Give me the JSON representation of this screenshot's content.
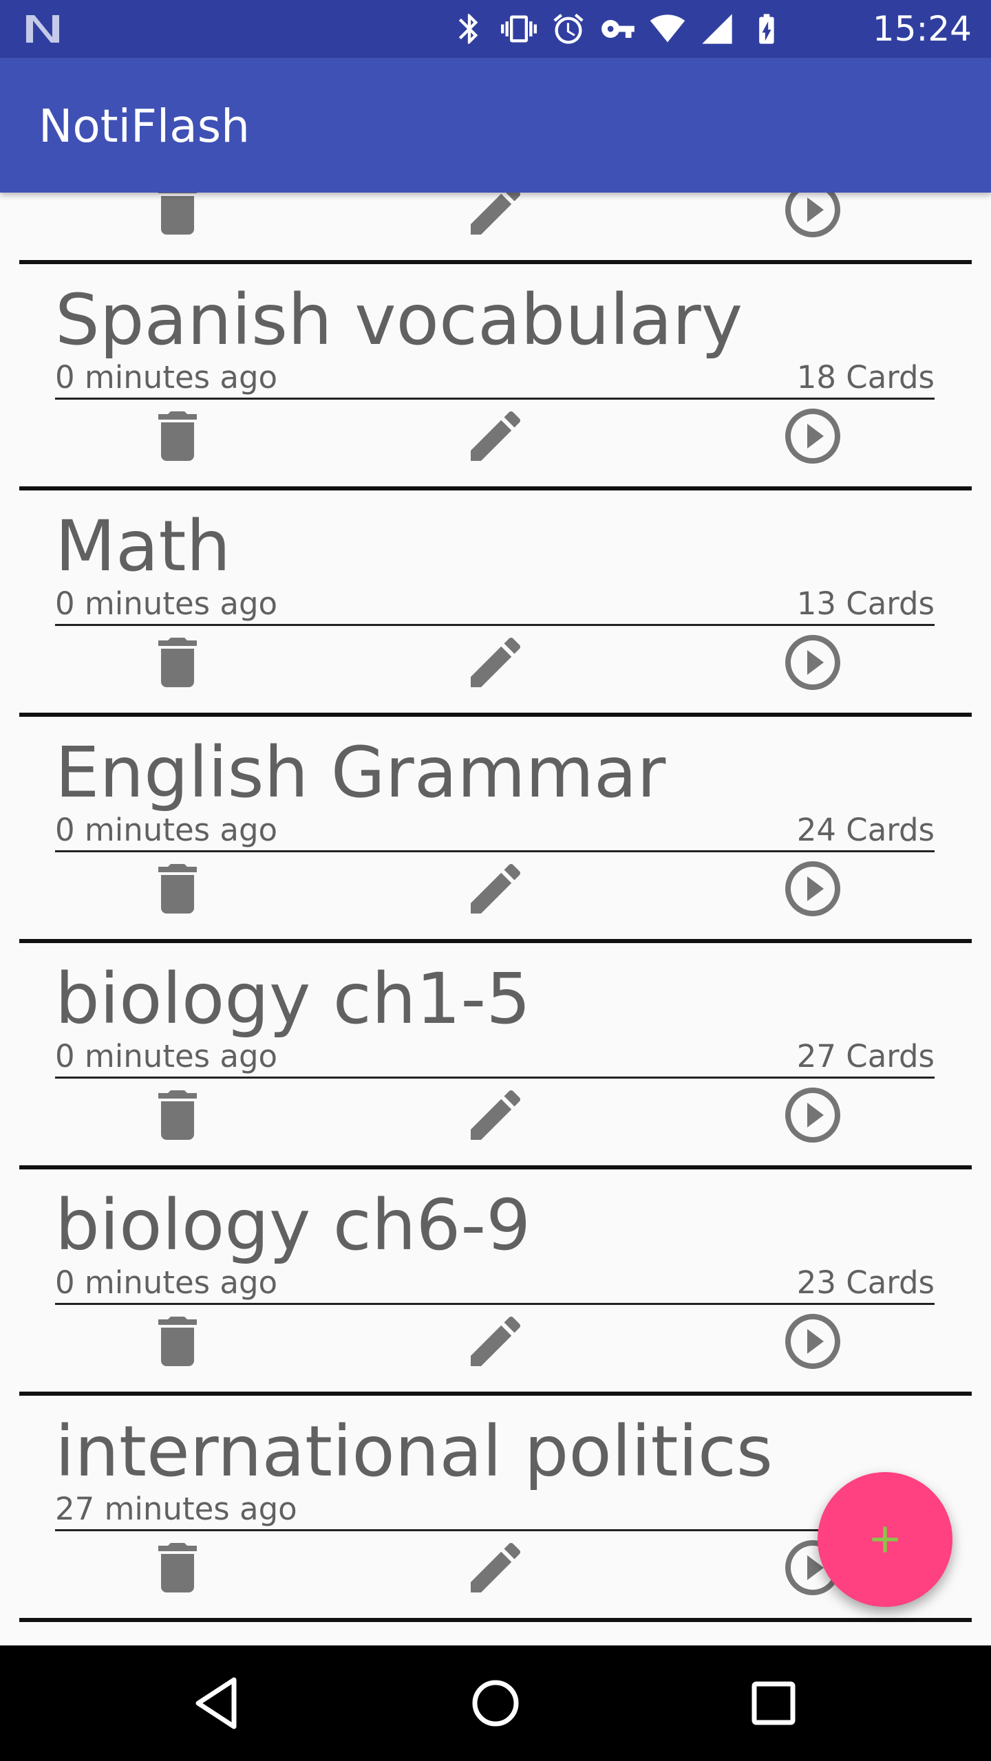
{
  "status_bar": {
    "time": "15:24",
    "icons": [
      "notification-n-icon",
      "bluetooth-icon",
      "vibrate-icon",
      "alarm-icon",
      "vpn-key-icon",
      "wifi-icon",
      "lte-signal-icon",
      "battery-charging-icon"
    ]
  },
  "app_bar": {
    "title": "NotiFlash"
  },
  "decks": [
    {
      "title": "",
      "time": "",
      "count": ""
    },
    {
      "title": "Spanish vocabulary",
      "time": "0 minutes ago",
      "count": "18 Cards"
    },
    {
      "title": "Math",
      "time": "0 minutes ago",
      "count": "13 Cards"
    },
    {
      "title": "English Grammar",
      "time": "0 minutes ago",
      "count": "24 Cards"
    },
    {
      "title": "biology ch1-5",
      "time": "0 minutes ago",
      "count": "27 Cards"
    },
    {
      "title": "biology ch6-9",
      "time": "0 minutes ago",
      "count": "23 Cards"
    },
    {
      "title": "international politics",
      "time": "27 minutes ago",
      "count": ""
    }
  ],
  "actions": {
    "delete_icon": "delete-icon",
    "edit_icon": "edit-icon",
    "play_icon": "play-icon"
  },
  "fab": {
    "icon": "add-icon",
    "color": "#ff4081",
    "plus_color": "#8bc34a"
  },
  "nav_bar": {
    "back_icon": "back-icon",
    "home_icon": "home-icon",
    "recents_icon": "recents-icon"
  },
  "colors": {
    "status_bar": "#303f9f",
    "app_bar": "#3f51b5",
    "text": "#616161",
    "icon": "#757575"
  }
}
